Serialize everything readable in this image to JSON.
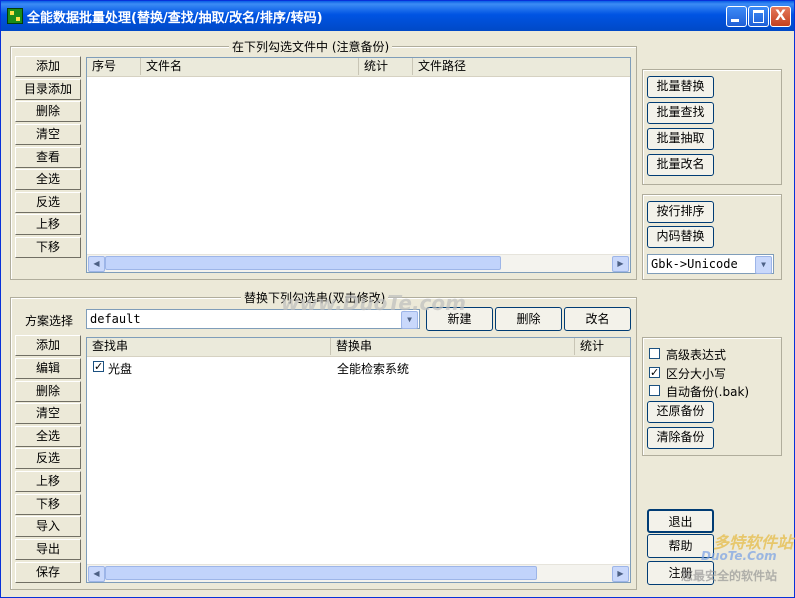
{
  "window": {
    "title": "全能数据批量处理(替换/查找/抽取/改名/排序/转码)",
    "buttons": {
      "close": "X"
    }
  },
  "files_group": {
    "title": "在下列勾选文件中 (注意备份)",
    "buttons": [
      "添加",
      "目录添加",
      "删除",
      "清空",
      "查看",
      "全选",
      "反选",
      "上移",
      "下移"
    ],
    "columns": [
      "序号",
      "文件名",
      "统计",
      "文件路径"
    ]
  },
  "ops_group": {
    "buttons": [
      "批量替换",
      "批量查找",
      "批量抽取",
      "批量改名"
    ]
  },
  "sort_group": {
    "buttons": [
      "按行排序",
      "内码替换"
    ],
    "encoding": "Gbk->Unicode"
  },
  "replace_group": {
    "title": "替换下列勾选串(双击修改)",
    "scheme_label": "方案选择",
    "scheme_value": "default",
    "scheme_buttons": [
      "新建",
      "删除",
      "改名"
    ],
    "buttons": [
      "添加",
      "编辑",
      "删除",
      "清空",
      "全选",
      "反选",
      "上移",
      "下移",
      "导入",
      "导出",
      "保存"
    ],
    "columns": [
      "查找串",
      "替换串",
      "统计"
    ],
    "rows": [
      {
        "checked": true,
        "find": "光盘",
        "replace": "全能检索系统",
        "count": ""
      }
    ]
  },
  "options_group": {
    "options": [
      {
        "label": "高级表达式",
        "checked": false
      },
      {
        "label": "区分大小写",
        "checked": true
      },
      {
        "label": "自动备份(.bak)",
        "checked": false
      }
    ],
    "buttons": [
      "还原备份",
      "清除备份"
    ]
  },
  "bottom_buttons": [
    "退出",
    "帮助",
    "注册"
  ],
  "watermarks": [
    "www.DuoTe.com",
    "多特软件站",
    "DuoTe.Com",
    "您最安全的软件站"
  ]
}
